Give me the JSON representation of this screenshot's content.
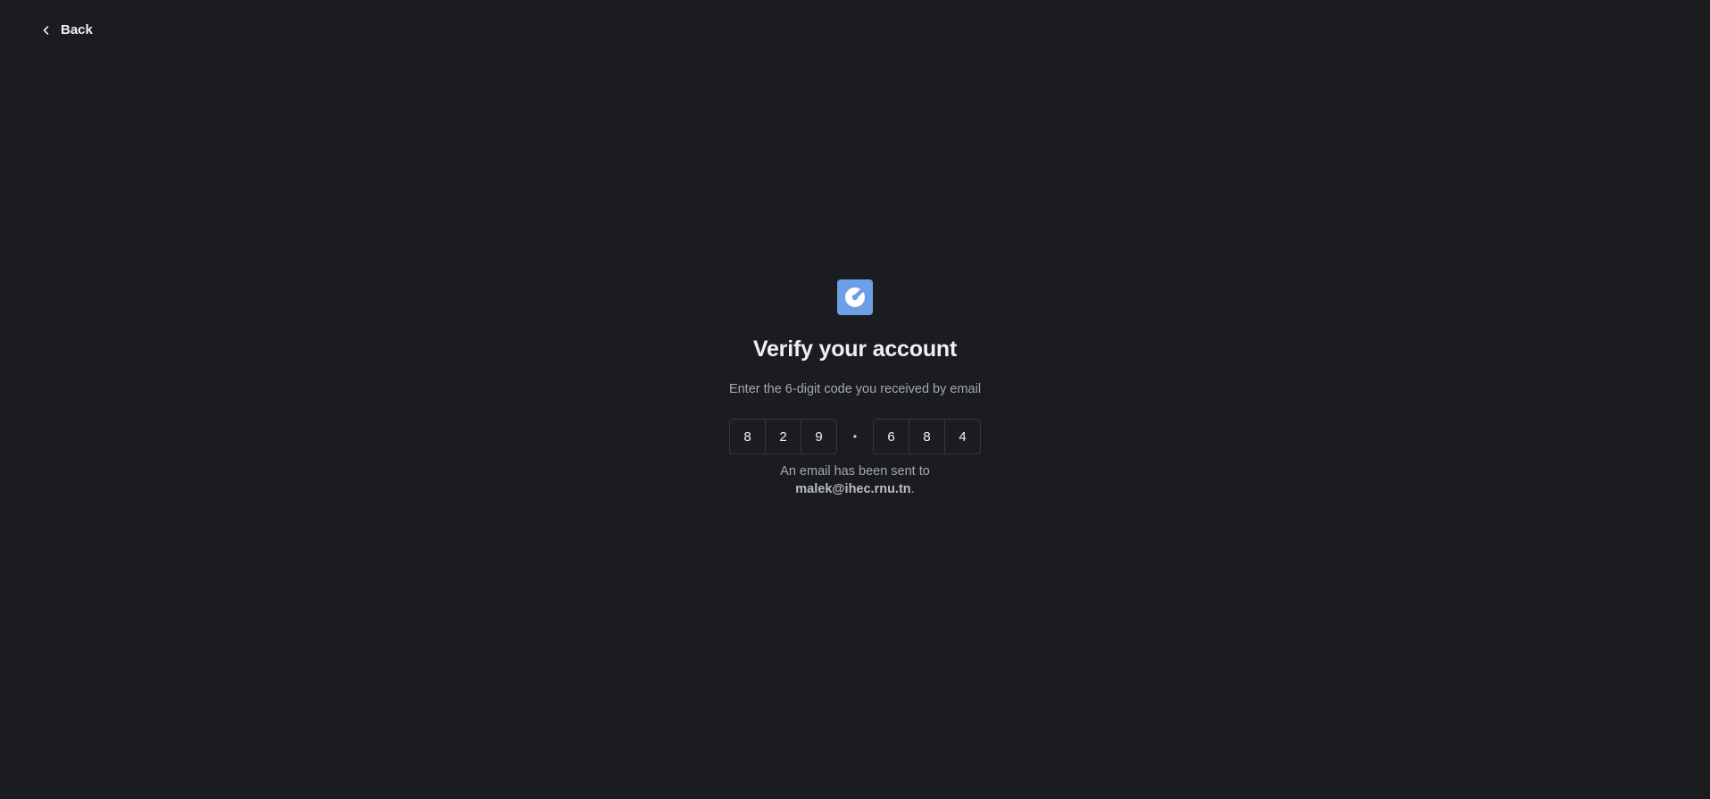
{
  "nav": {
    "back_label": "Back",
    "back_icon": "chevron-left-icon"
  },
  "logo": {
    "icon": "app-logo-icon",
    "color": "#6d9ee6"
  },
  "verify": {
    "title": "Verify your account",
    "subtitle": "Enter the 6-digit code you received by email",
    "code_group_1": [
      "8",
      "2",
      "9"
    ],
    "separator": "•",
    "code_group_2": [
      "6",
      "8",
      "4"
    ],
    "note_prefix": "An email has been sent to",
    "email": "malek@ihec.rnu.tn",
    "note_suffix": "."
  },
  "colors": {
    "background": "#1a1c1f",
    "accent": "#6d9ee6"
  }
}
